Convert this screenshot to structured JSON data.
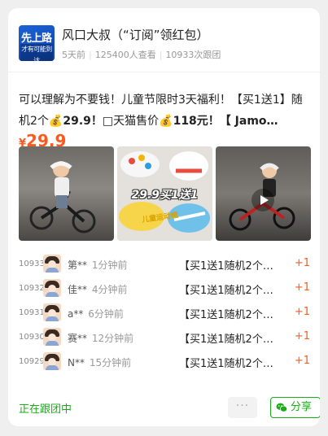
{
  "group": {
    "avatar_text_1": "先上路",
    "avatar_text_2": "才有可能到达",
    "title": "风口大叔（“订阅”领红包）",
    "posted": "5天前",
    "views": "125400人查看",
    "joined": "10933次跟团"
  },
  "product": {
    "description_lead": "可以理解为不要钱！儿童节限时3天福利！【买1送1】随机2个",
    "description_tail": "29.9！",
    "description_mid": "天猫售价",
    "description_end": "118元！【 Jamo…",
    "price_currency": "¥",
    "price_value": "29.9"
  },
  "images": {
    "promo_text": "29.9买1送1",
    "watermark_text": "儿童运动帽"
  },
  "orders": [
    {
      "num": "10933",
      "name": "第**",
      "time": "1分钟前",
      "product": "【买1送1随机2个…",
      "qty": "+1"
    },
    {
      "num": "10932",
      "name": "佳**",
      "time": "4分钟前",
      "product": "【买1送1随机2个…",
      "qty": "+1"
    },
    {
      "num": "10931",
      "name": "a**",
      "time": "6分钟前",
      "product": "【买1送1随机2个…",
      "qty": "+1"
    },
    {
      "num": "10930",
      "name": "赛**",
      "time": "12分钟前",
      "product": "【买1送1随机2个…",
      "qty": "+1"
    },
    {
      "num": "10929",
      "name": "N**",
      "time": "15分钟前",
      "product": "【买1送1随机2个…",
      "qty": "+1"
    }
  ],
  "footer": {
    "status": "正在跟团中",
    "more_label": "···",
    "share_label": "分享"
  },
  "colors": {
    "accent": "#fa5a1e",
    "brand_green": "#1aad19"
  }
}
